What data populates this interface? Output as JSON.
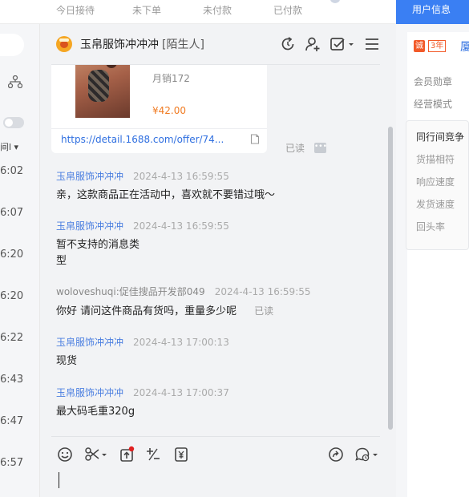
{
  "top_tabs": {
    "today_reception": "今日接待",
    "not_ordered": "未下单",
    "unpaid": "未付款",
    "paid": "已付款",
    "user_info": "用户信息"
  },
  "left_list": {
    "dropdown_label": "间l",
    "times": [
      "6:02",
      "6:07",
      "6:20",
      "6:20",
      "6:22",
      "6:43",
      "6:47",
      "6:57"
    ]
  },
  "header": {
    "contact_name": "玉帛服饰冲冲冲",
    "contact_tag": "[陌生人]"
  },
  "product_card": {
    "sales": "月销172",
    "price": "¥42.00",
    "link": "https://detail.1688.com/offer/74...",
    "read_status": "已读",
    "more_label": "•••"
  },
  "messages": [
    {
      "sender": "玉帛服饰冲冲冲",
      "time": "2024-4-13 16:59:55",
      "lines": [
        "亲，这款商品正在活动中，喜欢就不要错过哦～"
      ]
    },
    {
      "sender": "玉帛服饰冲冲冲",
      "time": "2024-4-13 16:59:55",
      "lines": [
        "暂不支持的消息类",
        "型"
      ]
    },
    {
      "sender": "woloveshuqi:促佳搜品开发部049",
      "time": "2024-4-13 16:59:55",
      "lines": [
        "你好 请问这件商品有货吗，重量多少呢"
      ],
      "read": "已读"
    },
    {
      "sender": "玉帛服饰冲冲冲",
      "time": "2024-4-13 17:00:13",
      "lines": [
        "现货"
      ]
    },
    {
      "sender": "玉帛服饰冲冲冲",
      "time": "2024-4-13 17:00:37",
      "lines": [
        "最大码毛重320g"
      ]
    }
  ],
  "right_panel": {
    "badge_label": "诚",
    "badge_years": "3年",
    "shop_initial": "厦",
    "member_badge": "会员勋章",
    "business_mode": "经营模式",
    "peer_title": "同行间竞争",
    "peer_items": [
      "货描相符",
      "响应速度",
      "发货速度",
      "回头率"
    ]
  },
  "icons": {
    "header": [
      "refresh-icon",
      "add-contact-icon",
      "task-icon",
      "menu-icon"
    ],
    "toolbar": [
      "emoji-icon",
      "scissors-icon",
      "upload-icon",
      "plus-minus-icon",
      "price-tag-icon",
      "share-icon",
      "history-icon"
    ]
  },
  "colors": {
    "accent": "#3a7ff3",
    "sender": "#4a7ee0",
    "price": "#f07b22",
    "badge": "#f25a29",
    "notification_dot": "#e02020"
  }
}
